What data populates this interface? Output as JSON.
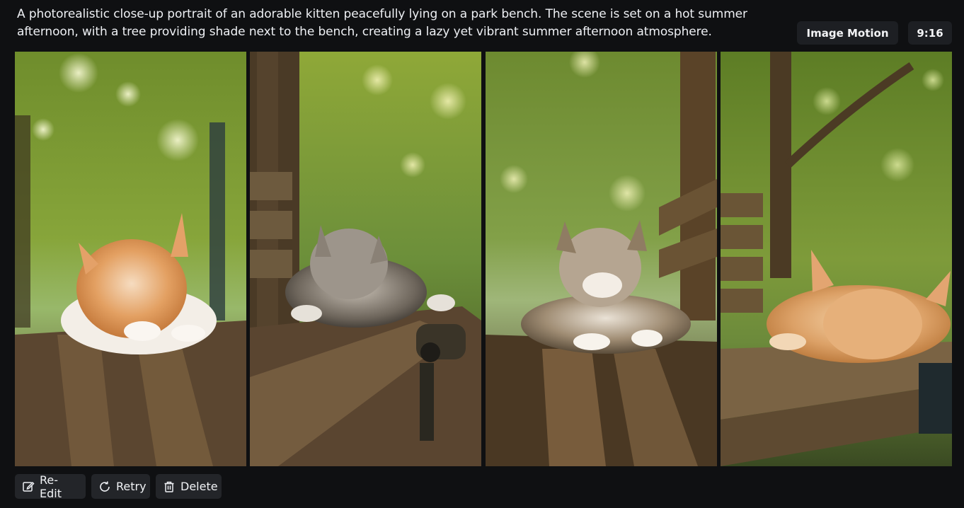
{
  "prompt": {
    "text": "A photorealistic close-up portrait of an adorable kitten peacefully lying on a park bench. The scene is set on a hot summer afternoon, with a tree providing shade next to the bench, creating a lazy yet vibrant summer afternoon atmosphere."
  },
  "chips": {
    "mode": "Image Motion",
    "ratio": "9:16"
  },
  "images": [
    {
      "subject": "orange-white kitten sleeping on bench"
    },
    {
      "subject": "tabby kitten sleeping on bench near tree"
    },
    {
      "subject": "tabby kitten lying on bench facing camera"
    },
    {
      "subject": "orange kitten sleeping on bench edge"
    }
  ],
  "actions": {
    "reedit_label": "Re-Edit",
    "retry_label": "Retry",
    "delete_label": "Delete",
    "reedit_icon": "edit-icon",
    "retry_icon": "retry-icon",
    "delete_icon": "trash-icon"
  },
  "colors": {
    "background": "#0f1012",
    "chip_bg": "#1d1f23",
    "button_bg": "#232529",
    "text": "#eef0f4"
  }
}
